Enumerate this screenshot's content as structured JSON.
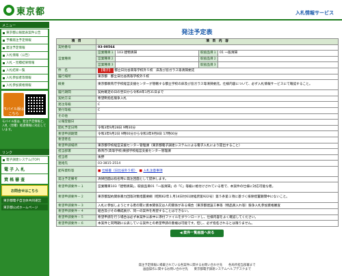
{
  "header": {
    "logo_text": "東京都",
    "service_title": "入札情報サービス"
  },
  "sidebar": {
    "menu_head": "メニュー",
    "items": [
      {
        "label": "東京都公報発表案件公告"
      },
      {
        "label": "予備発注予定情報"
      },
      {
        "label": "発注予定情報"
      },
      {
        "label": "入札情報（公告）"
      },
      {
        "label": "入札・見積結果情報"
      },
      {
        "label": "入札結果一覧"
      },
      {
        "label": "入札参加者等情報"
      },
      {
        "label": "入札参加資格情報"
      }
    ],
    "mobile_label": "モバイル版はこちら",
    "mobile_note": "モバイル版は、発注予定情報と、入札（見積）経過情報に対応しています。",
    "links_head": "リンク",
    "link_system": "電子調達システム(TOP)",
    "big1": "電 子 入 札",
    "big2": "資 格 審 査",
    "yellow": "お問合せはこちら",
    "yellow_sub": "電子調達ネットサポート",
    "footer_links": [
      {
        "label": "東京都電子自治体共同運営"
      },
      {
        "label": "東京都公式ホームページ"
      }
    ]
  },
  "page": {
    "title": "発注予定表",
    "col_item": "項　目",
    "col_content": "項　目　内　容",
    "back_button": "案件一覧画面へ戻る"
  },
  "rows": {
    "contract_no_label": "契約番号",
    "contract_no": "03-00564",
    "biz_type_label": "営業種目",
    "biz1": "営業種目１",
    "biz1_val": "103 建物清掃",
    "biz2": "営業種目２",
    "biz3": "営業種目３",
    "goods1": "取扱品目１",
    "goods1_val": "01 一般清掃",
    "goods2": "取扱品目２",
    "goods3": "取扱品目３",
    "name_label": "件　名",
    "name_tag": "【電子】",
    "name_val": "都立日比谷高等学校外５校　床及び窓ガラス等清掃委託",
    "place_label": "履行場所",
    "place_val": "東京都　都立日比谷高等学校外５校",
    "summary_label": "概要",
    "summary_val": "東京都教育庁学校経営支援センターが管轄する都立学校の床及び窓ガラス等清掃委託。仕様内容について、必ず入札情報サービスにて確認すること。",
    "period_label": "履行期間",
    "period_val": "契約確定の日の翌日から令和4年1月31日まで",
    "method_label": "契約方法",
    "method_val": "希望制指名競争入札",
    "order_type_label": "発注等級",
    "order_type_val": "C",
    "recv_type_label": "受付等級",
    "recv_type_val": "C",
    "other_label": "その他",
    "other_val": "",
    "pub_date_label": "公報登載日",
    "pub_date_val": "",
    "open_date_label": "開札予定日時",
    "open_date_val": "令和3年9月28日 9時30分",
    "apply_label": "希望申請期間",
    "apply_val": "令和3年9月2日 9時00分から令和3年9月8日 17時00分",
    "applicant_label": "希望者名",
    "apply_place_label": "希望申請場所",
    "apply_place_val": "東京都学校経営支援センター管理課（東京都電子調達システムによる電子入札により提出すること）",
    "dept_label": "担当部署",
    "dept_val": "教育庁(高等学校)東部学校経営支援センター管理課",
    "person_label": "担当者",
    "person_val": "後野",
    "phone_label": "連絡先",
    "phone_val": "03-3815-2514",
    "attach_label": "配布資料等",
    "attach1": "仕様書（日比谷外５校）",
    "attach2": "入札注意事項",
    "note_label": "発注予定備考",
    "note_val": "清掃回面は指名時に発注回面として提供します。",
    "req_labels": [
      "希望申請要件－１",
      "希望申請要件－２",
      "希望申請要件－３",
      "希望申請要件－４",
      "希望申請要件－５",
      "希望申請要件－６"
    ],
    "req_vals": [
      "営業種目103「建物清掃」、取扱品目01「一般清掃」の「C」等級に格付けされている者で、本案件の仕様に対応可能な者。",
      "東京都契約関係暴力団等対策措置要綱（昭和62年１月14日付61財経庶第922号）第５条第１項に基づく排除措置期間中にないこと。",
      "入札に参加しようとする者の間に資本関係又は人的関係がある場合（東京都建設工事等（物品買入れ等）競争入札参加資格審査",
      "組合及びその構成員が、同一の案件を希望することはできない。",
      "希望申請を行う場合は必ず本案件公表中に添付ファイルをダウンロードし、仕様内容をよく確認してください。",
      "本案件と同時期に公表している案件との希望申請の重複は可能です。但し、必ず指名されるとは限りません。"
    ]
  },
  "footer": {
    "line1": "発注予定情報に掲載されている各案件に関するお問い合わせ先　　各局所担当部署まで",
    "line2": "画面操作に関するお問い合わせ先　　東京都電子調達システムヘルプデスクまで"
  }
}
